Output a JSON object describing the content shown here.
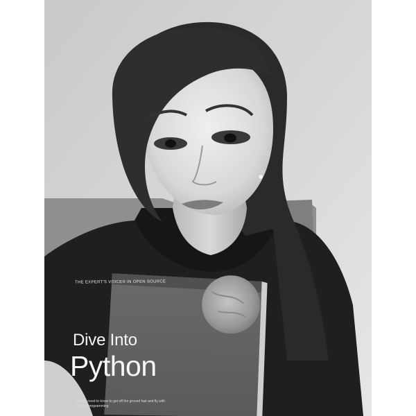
{
  "photo": {
    "style": "black-and-white selfie",
    "book": {
      "series_line": "THE EXPERT'S VOICE® IN OPEN SOURCE",
      "title_line_1": "Dive Into",
      "title_line_2": "Python",
      "blurb": "All you need to know to get off the ground fast and fly with Python programming"
    }
  }
}
